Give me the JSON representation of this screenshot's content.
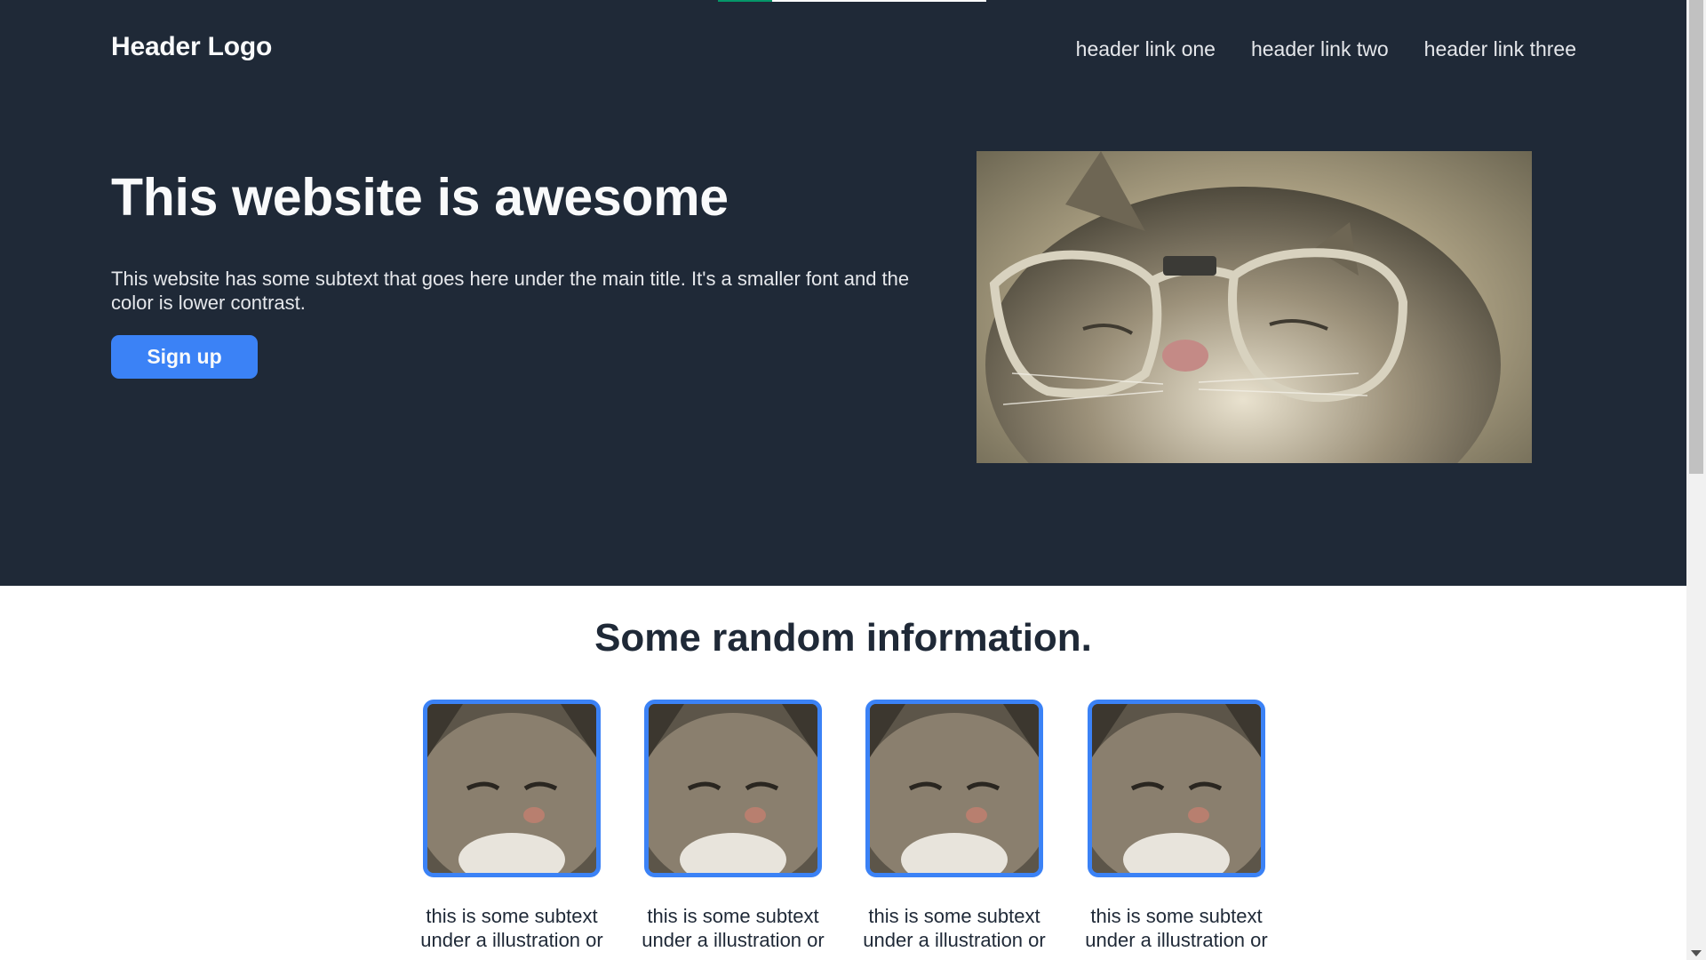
{
  "header": {
    "logo": "Header Logo",
    "links": [
      "header link one",
      "header link two",
      "header link three"
    ]
  },
  "hero": {
    "title": "This website is awesome",
    "subtext": "This website has some subtext that goes here under the main title. It's a smaller font and the color is lower contrast.",
    "cta_label": "Sign up",
    "image_icon": "cat-with-glasses-photo"
  },
  "info": {
    "title": "Some random information.",
    "cards": [
      {
        "icon": "cat-photo",
        "text": "this is some subtext under a illustration or"
      },
      {
        "icon": "cat-photo",
        "text": "this is some subtext under a illustration or"
      },
      {
        "icon": "cat-photo",
        "text": "this is some subtext under a illustration or"
      },
      {
        "icon": "cat-photo",
        "text": "this is some subtext under a illustration or"
      }
    ]
  },
  "colors": {
    "hero_bg": "#1f2937",
    "accent": "#3b82f6",
    "text_light": "#f9fafb",
    "text_dark": "#1f2937"
  }
}
